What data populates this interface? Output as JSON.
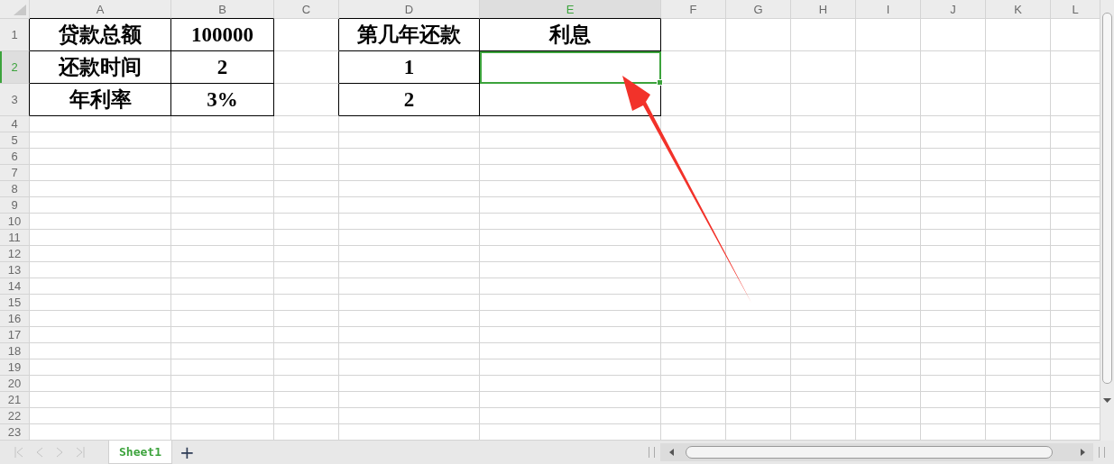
{
  "columns": [
    {
      "label": "A",
      "selected": false
    },
    {
      "label": "B",
      "selected": false
    },
    {
      "label": "C",
      "selected": false
    },
    {
      "label": "D",
      "selected": false
    },
    {
      "label": "E",
      "selected": true
    },
    {
      "label": "F",
      "selected": false
    },
    {
      "label": "G",
      "selected": false
    },
    {
      "label": "H",
      "selected": false
    },
    {
      "label": "I",
      "selected": false
    },
    {
      "label": "J",
      "selected": false
    },
    {
      "label": "K",
      "selected": false
    },
    {
      "label": "L",
      "selected": false
    }
  ],
  "rows": [
    {
      "label": "1",
      "selected": false,
      "cells": [
        {
          "kind": "value",
          "text": "贷款总额",
          "selected": false
        },
        {
          "kind": "value",
          "text": "100000",
          "selected": false
        },
        {
          "kind": "gap",
          "selected": false
        },
        {
          "kind": "value",
          "text": "第几年还款",
          "selected": false
        },
        {
          "kind": "value",
          "text": "利息",
          "selected": false
        }
      ]
    },
    {
      "label": "2",
      "selected": true,
      "cells": [
        {
          "kind": "value",
          "text": "还款时间",
          "selected": false
        },
        {
          "kind": "value",
          "text": "2",
          "selected": false
        },
        {
          "kind": "gap",
          "selected": false
        },
        {
          "kind": "value",
          "text": "1",
          "selected": false
        },
        {
          "kind": "blank",
          "selected": true
        }
      ]
    },
    {
      "label": "3",
      "selected": false,
      "cells": [
        {
          "kind": "value",
          "text": "年利率",
          "selected": false
        },
        {
          "kind": "value",
          "text": "3%",
          "selected": false
        },
        {
          "kind": "gap",
          "selected": false
        },
        {
          "kind": "value",
          "text": "2",
          "selected": false
        },
        {
          "kind": "blank",
          "selected": false
        }
      ]
    },
    {
      "label": "4",
      "selected": false
    },
    {
      "label": "5",
      "selected": false
    },
    {
      "label": "6",
      "selected": false
    },
    {
      "label": "7",
      "selected": false
    },
    {
      "label": "8",
      "selected": false
    },
    {
      "label": "9",
      "selected": false
    },
    {
      "label": "10",
      "selected": false
    },
    {
      "label": "11",
      "selected": false
    },
    {
      "label": "12",
      "selected": false
    },
    {
      "label": "13",
      "selected": false
    },
    {
      "label": "14",
      "selected": false
    },
    {
      "label": "15",
      "selected": false
    },
    {
      "label": "16",
      "selected": false
    },
    {
      "label": "17",
      "selected": false
    },
    {
      "label": "18",
      "selected": false
    },
    {
      "label": "19",
      "selected": false
    },
    {
      "label": "20",
      "selected": false
    },
    {
      "label": "21",
      "selected": false
    },
    {
      "label": "22",
      "selected": false
    },
    {
      "label": "23",
      "selected": false
    }
  ],
  "sheet_tabs": [
    {
      "label": "Sheet1",
      "selected": true
    }
  ],
  "add_sheet": "+"
}
